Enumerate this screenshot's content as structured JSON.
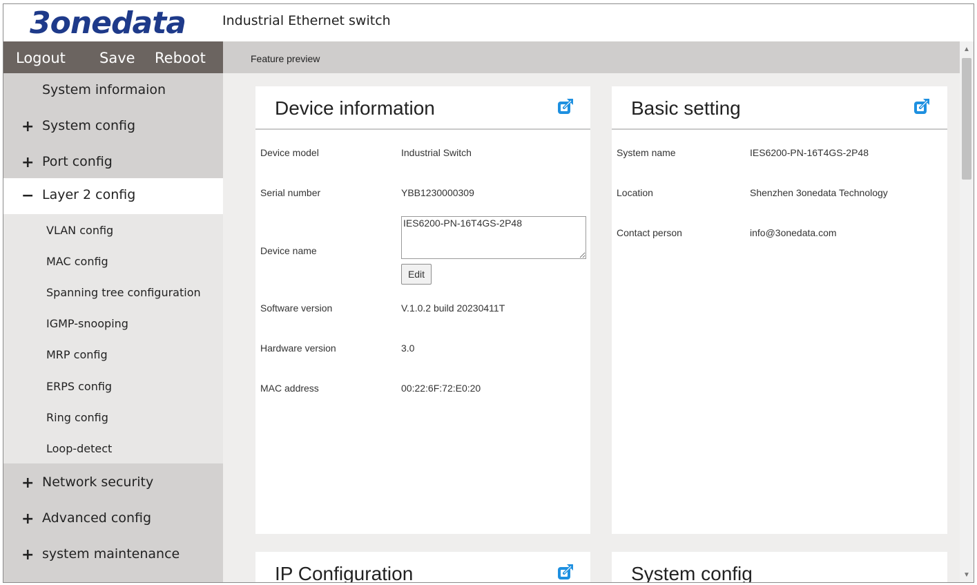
{
  "header": {
    "logo": "3onedata",
    "product_title": "Industrial Ethernet switch"
  },
  "actions": {
    "logout": "Logout",
    "save": "Save",
    "reboot": "Reboot"
  },
  "breadcrumb": "Feature preview",
  "sidebar": {
    "items": [
      {
        "sign": "",
        "label": "System informaion"
      },
      {
        "sign": "+",
        "label": "System config"
      },
      {
        "sign": "+",
        "label": "Port config"
      },
      {
        "sign": "−",
        "label": "Layer 2 config"
      },
      {
        "sign": "+",
        "label": "Network security"
      },
      {
        "sign": "+",
        "label": "Advanced config"
      },
      {
        "sign": "+",
        "label": "system maintenance"
      }
    ],
    "layer2_sub": [
      "VLAN config",
      "MAC config",
      "Spanning tree configuration",
      "IGMP-snooping",
      "MRP config",
      "ERPS config",
      "Ring config",
      "Loop-detect"
    ]
  },
  "device_info": {
    "title": "Device information",
    "rows": [
      {
        "label": "Device model",
        "value": "Industrial Switch"
      },
      {
        "label": "Serial number",
        "value": "YBB1230000309"
      },
      {
        "label": "Device name",
        "value": "IES6200-PN-16T4GS-2P48"
      },
      {
        "label": "Software version",
        "value": "V.1.0.2 build 20230411T"
      },
      {
        "label": "Hardware version",
        "value": "3.0"
      },
      {
        "label": "MAC address",
        "value": "00:22:6F:72:E0:20"
      }
    ],
    "edit_label": "Edit"
  },
  "basic_setting": {
    "title": "Basic setting",
    "rows": [
      {
        "label": "System name",
        "value": "IES6200-PN-16T4GS-2P48"
      },
      {
        "label": "Location",
        "value": "Shenzhen 3onedata Technology"
      },
      {
        "label": "Contact person",
        "value": "info@3onedata.com"
      }
    ]
  },
  "ip_config": {
    "title": "IP Configuration"
  },
  "system_config": {
    "title": "System config"
  },
  "colors": {
    "accent": "#1e90e0",
    "logo": "#1e3a8a",
    "actionbar": "#6b6460"
  },
  "icons": {
    "external": "external-link-icon"
  }
}
